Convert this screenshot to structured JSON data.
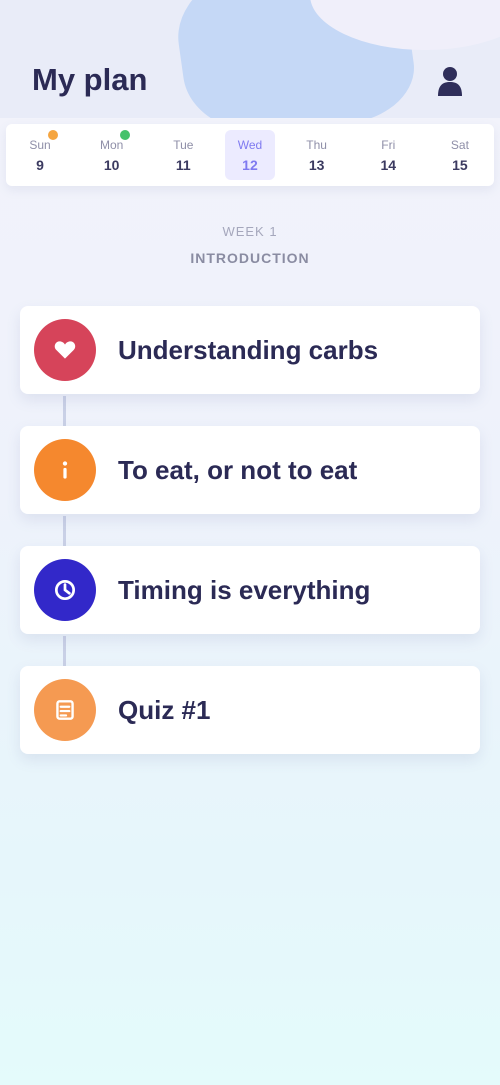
{
  "header": {
    "title": "My plan",
    "avatar_icon": "user-icon"
  },
  "days": [
    {
      "name": "Sun",
      "num": "9",
      "dot": "#f5a540"
    },
    {
      "name": "Mon",
      "num": "10",
      "dot": "#45c26b"
    },
    {
      "name": "Tue",
      "num": "11",
      "dot": null
    },
    {
      "name": "Wed",
      "num": "12",
      "dot": null,
      "active": true
    },
    {
      "name": "Thu",
      "num": "13",
      "dot": null
    },
    {
      "name": "Fri",
      "num": "14",
      "dot": null
    },
    {
      "name": "Sat",
      "num": "15",
      "dot": null
    }
  ],
  "week": {
    "label": "WEEK 1",
    "subtitle": "INTRODUCTION"
  },
  "lessons": [
    {
      "title": "Understanding carbs",
      "color": "#d6445a",
      "icon": "heart-icon"
    },
    {
      "title": "To eat, or not to eat",
      "color": "#f5882e",
      "icon": "info-icon"
    },
    {
      "title": "Timing is everything",
      "color": "#3228c9",
      "icon": "clock-icon"
    },
    {
      "title": "Quiz #1",
      "color": "#f59a52",
      "icon": "quiz-icon"
    }
  ]
}
